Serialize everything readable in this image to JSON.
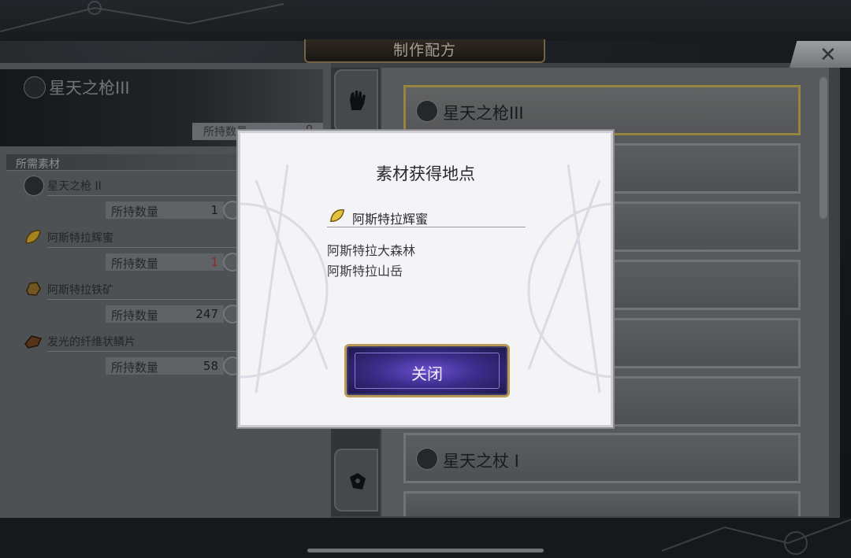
{
  "window": {
    "title": "制作配方"
  },
  "header": {
    "item_name": "星天之枪III",
    "owned_label": "所持数量",
    "owned_value": "0"
  },
  "materials": {
    "section_label": "所需素材",
    "items": [
      {
        "name": "星天之枪 II",
        "owned_label": "所持数量",
        "owned_value": "1",
        "icon": "spear-medallion-icon"
      },
      {
        "name": "阿斯特拉辉蜜",
        "owned_label": "所持数量",
        "owned_value": "1",
        "icon": "honey-leaf-icon",
        "value_color": "#a8322c"
      },
      {
        "name": "阿斯特拉铁矿",
        "owned_label": "所持数量",
        "owned_value": "247",
        "icon": "iron-ore-icon"
      },
      {
        "name": "发光的纤维状鳞片",
        "owned_label": "所持数量",
        "owned_value": "58",
        "icon": "scale-icon"
      }
    ]
  },
  "tabs": [
    {
      "icon": "glove-icon"
    },
    {
      "icon": "accessory-icon"
    }
  ],
  "recipe_list": [
    {
      "name": "星天之枪III",
      "selected": true
    },
    {
      "name": "星天之杖 I",
      "selected": false
    }
  ],
  "modal": {
    "title": "素材获得地点",
    "item_name": "阿斯特拉辉蜜",
    "locations": [
      "阿斯特拉大森林",
      "阿斯特拉山岳"
    ],
    "close_label": "关闭"
  },
  "colors": {
    "accent_gold": "#b7a24d",
    "button_purple": "#3b2d8a",
    "warning_red": "#a8322c"
  }
}
